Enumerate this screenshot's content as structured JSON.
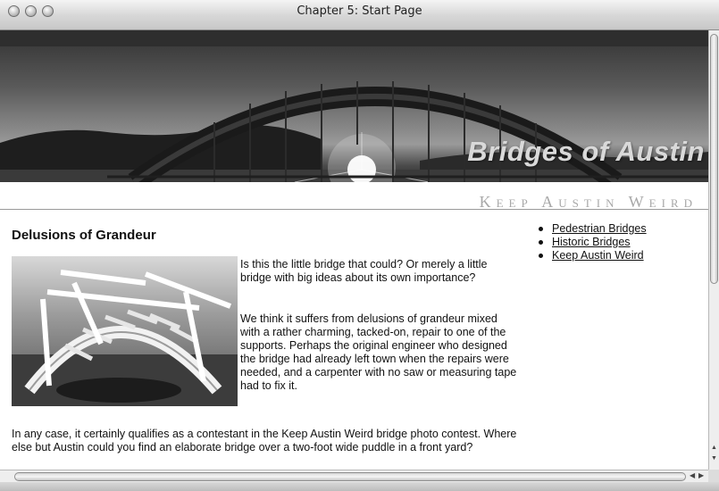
{
  "window": {
    "title": "Chapter 5: Start Page"
  },
  "banner": {
    "title": "Bridges of Austin",
    "tagline": "Keep Austin Weird"
  },
  "article": {
    "heading": "Delusions of Grandeur",
    "paragraphs": [
      "Is this the little bridge that could? Or merely a little bridge with big ideas about its own importance?",
      "We think it suffers from delusions of grandeur mixed with a rather charming, tacked-on, repair to one of the supports. Perhaps the original engineer who designed the bridge had already left town when the repairs were needed, and a carpenter with no saw or measuring tape had to fix it.",
      "In any case, it certainly qualifies as a contestant in the Keep Austin Weird bridge photo contest. Where else but Austin could you find an elaborate bridge over a two-foot wide puddle in a front yard?"
    ]
  },
  "nav": {
    "links": [
      "Pedestrian Bridges",
      "Historic Bridges",
      "Keep Austin Weird"
    ]
  }
}
